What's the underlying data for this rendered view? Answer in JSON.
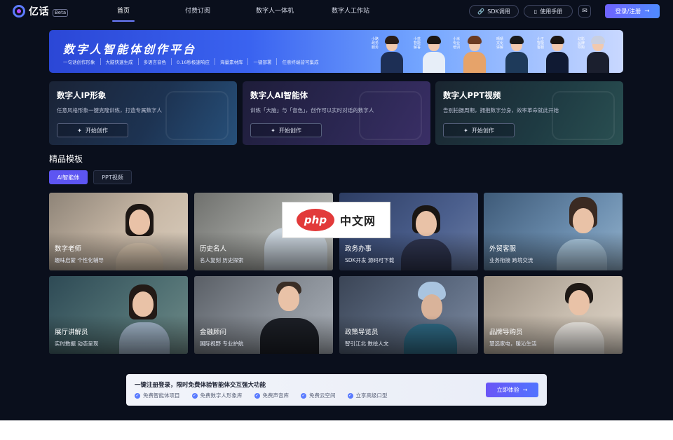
{
  "header": {
    "logo_text": "亿话",
    "logo_badge": "Beta",
    "nav": [
      {
        "label": "首页",
        "active": true
      },
      {
        "label": "付费订阅",
        "active": false
      },
      {
        "label": "数字人一体机",
        "active": false
      },
      {
        "label": "数字人工作站",
        "active": false
      }
    ],
    "sdk_label": "SDK调用",
    "manual_label": "使用手册",
    "mail_icon": "mail-icon",
    "login_label": "登录/注册"
  },
  "banner": {
    "title": "数字人智能体创作平台",
    "tags": [
      "一句话创作形象",
      "大脑快速生成",
      "多语言音色",
      "0.16秒极速响应",
      "海量素材库",
      "一键部署",
      "任意终端皆可集成"
    ],
    "people_labels": [
      "小路 政务服务",
      "小蓝 智能解答",
      "小米 专业培训",
      "晴晴 文化讲解",
      "小王 智能客服",
      "幻影 品牌导购"
    ]
  },
  "cards": [
    {
      "title": "数字人IP形象",
      "desc": "任意风格形象一键克隆训练，打造专属数字人",
      "button": "开始创作"
    },
    {
      "title": "数字人AI智能体",
      "desc": "训练「大脑」与「音色」，创作可以实时对话的数字人",
      "button": "开始创作"
    },
    {
      "title": "数字人PPT视频",
      "desc": "告别拍摄周期，拥抱数字分身，效率革命就此开始",
      "button": "开始创作"
    }
  ],
  "templates": {
    "title": "精品模板",
    "filters": [
      {
        "label": "AI智能体",
        "active": true
      },
      {
        "label": "PPT视频",
        "active": false
      }
    ],
    "items": [
      {
        "name": "数字老师",
        "sub": "趣味启蒙 个性化辅导"
      },
      {
        "name": "历史名人",
        "sub": "名人复刻 历史探索"
      },
      {
        "name": "政务办事",
        "sub": "SDK开发 源码可下载"
      },
      {
        "name": "外贸客服",
        "sub": "业务衔接 跨境交流"
      },
      {
        "name": "展厅讲解员",
        "sub": "实时数据 动态呈现"
      },
      {
        "name": "金融顾问",
        "sub": "国际视野 专业护航"
      },
      {
        "name": "政策导览员",
        "sub": "智引江北 数绘人文"
      },
      {
        "name": "品牌导购员",
        "sub": "慧选家电，暖沁生活"
      }
    ]
  },
  "watermark": {
    "logo": "php",
    "text": "中文网"
  },
  "promo": {
    "title": "一键注册登录，限时免费体验智能体交互强大功能",
    "features": [
      "免费智能体项目",
      "免费数字人形象库",
      "免费声音库",
      "免费云空间",
      "立享高级口型"
    ],
    "button": "立即体验"
  },
  "colors": {
    "accent": "#5d55f2",
    "page_bg": "#0a0f1c",
    "banner_blue": "#3a63f0"
  }
}
